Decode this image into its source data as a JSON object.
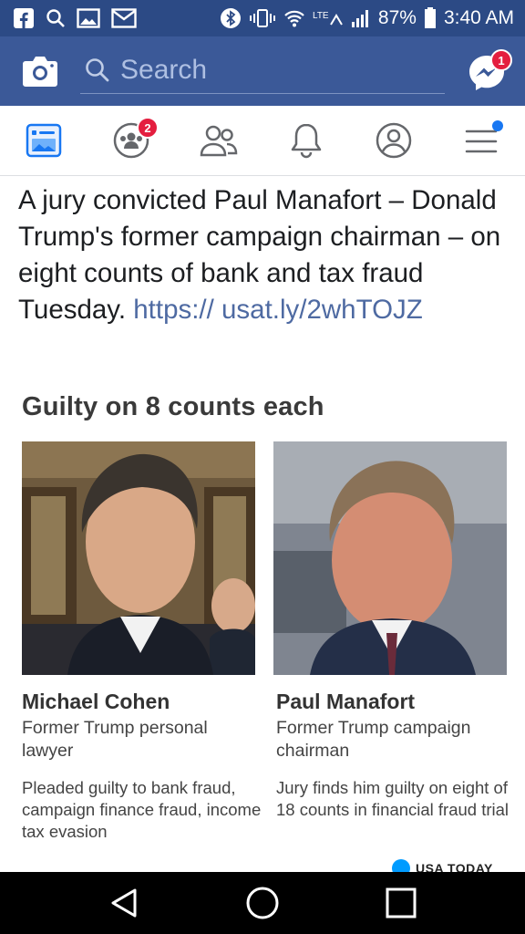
{
  "status_bar": {
    "battery": "87%",
    "time": "3:40 AM",
    "left_icons": [
      "facebook-icon",
      "search-icon",
      "gallery-icon",
      "mail-icon"
    ],
    "right_icons": [
      "bluetooth-icon",
      "vibrate-icon",
      "wifi-icon",
      "lte-icon",
      "signal-icon",
      "battery-icon"
    ]
  },
  "header": {
    "search_placeholder": "Search",
    "messenger_badge": "1",
    "accent_color": "#3b5998"
  },
  "tabs": [
    {
      "name": "news-feed",
      "icon": "news-feed-icon",
      "active": true
    },
    {
      "name": "groups",
      "icon": "groups-icon",
      "badge": "2"
    },
    {
      "name": "friends",
      "icon": "friends-icon"
    },
    {
      "name": "notifications",
      "icon": "bell-icon"
    },
    {
      "name": "profile",
      "icon": "profile-icon"
    },
    {
      "name": "menu",
      "icon": "menu-icon",
      "dot": true
    }
  ],
  "post": {
    "text": "A jury convicted Paul Manafort – Donald Trump's former campaign chairman – on eight counts of bank and tax fraud Tuesday.",
    "link": "https:// usat.ly/2whTOJZ"
  },
  "graphic": {
    "title": "Guilty on 8 counts each",
    "people": [
      {
        "name": "Michael Cohen",
        "role": "Former Trump personal lawyer",
        "note": "Pleaded guilty to bank fraud, campaign finance fraud, income tax evasion"
      },
      {
        "name": "Paul Manafort",
        "role": "Former Trump campaign chairman",
        "note": "Jury finds him guilty on eight of 18 counts in financial fraud trial"
      }
    ],
    "source": "USA TODAY"
  },
  "nav_bar": {
    "buttons": [
      "back-icon",
      "home-icon",
      "recents-icon"
    ]
  }
}
